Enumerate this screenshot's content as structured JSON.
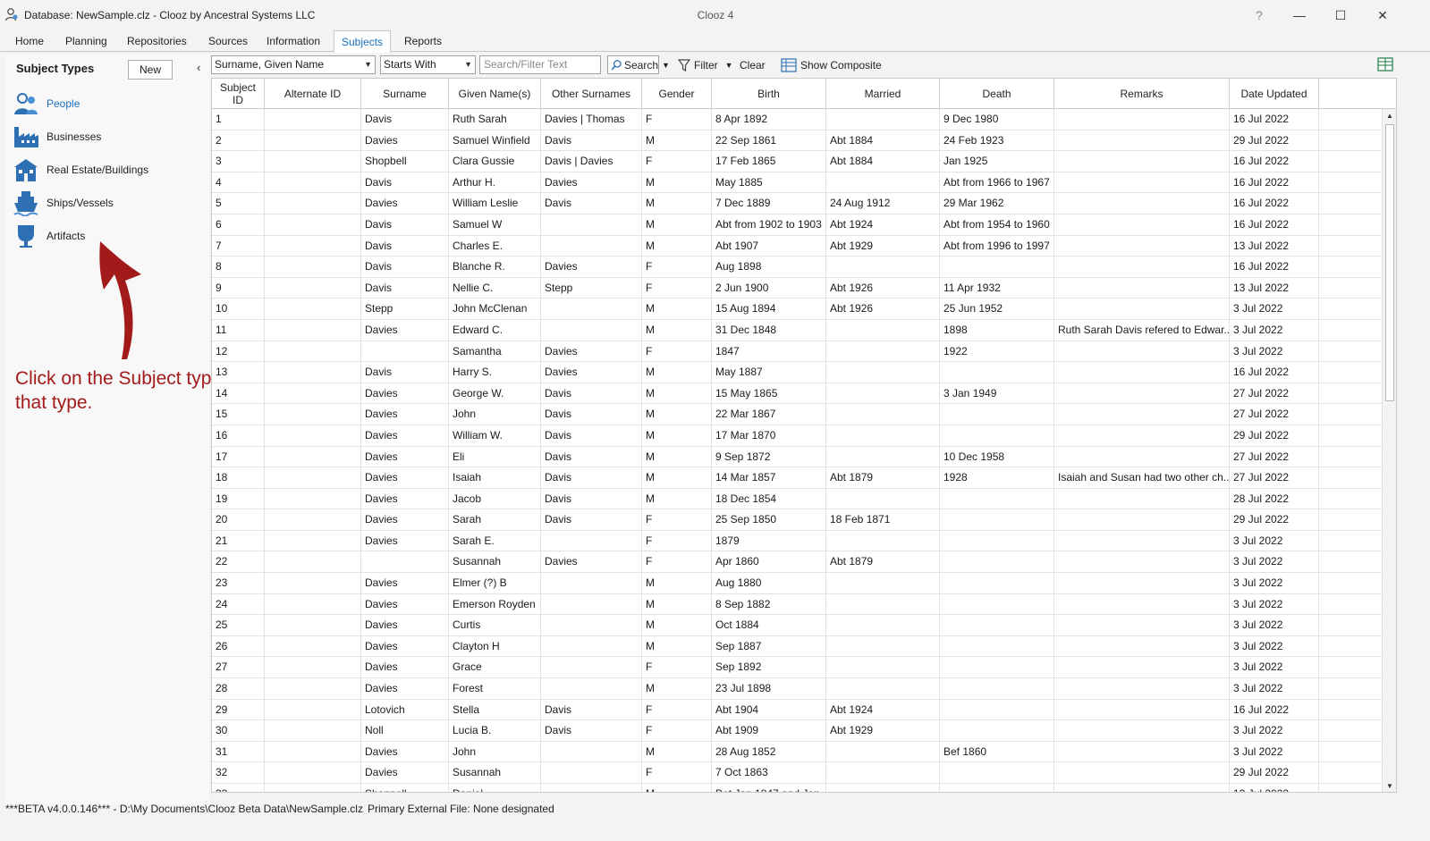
{
  "window": {
    "title": "Database: NewSample.clz - Clooz by Ancestral Systems LLC",
    "center_title": "Clooz 4",
    "help": "?",
    "minimize": "—",
    "maximize": "☐",
    "close": "✕"
  },
  "menu": {
    "tabs": [
      "Home",
      "Planning",
      "Repositories",
      "Sources",
      "Information",
      "Subjects",
      "Reports"
    ],
    "active": "Subjects"
  },
  "left_panel": {
    "header": "Subject Types",
    "new_label": "New",
    "collapse": "‹",
    "items": [
      {
        "label": "People",
        "icon": "people-icon",
        "active": true
      },
      {
        "label": "Businesses",
        "icon": "factory-icon",
        "active": false
      },
      {
        "label": "Real Estate/Buildings",
        "icon": "building-icon",
        "active": false
      },
      {
        "label": "Ships/Vessels",
        "icon": "ship-icon",
        "active": false
      },
      {
        "label": "Artifacts",
        "icon": "vase-icon",
        "active": false
      }
    ],
    "annotation_line1": "Click on the Subject type to list",
    "annotation_line2": "that type."
  },
  "toolbar": {
    "sort_select": "Surname, Given Name",
    "match_select": "Starts With",
    "search_placeholder": "Search/Filter Text",
    "search_label": "Search",
    "filter_label": "Filter",
    "clear_label": "Clear",
    "composite_label": "Show Composite"
  },
  "grid": {
    "columns": [
      "Subject ID",
      "Alternate ID",
      "Surname",
      "Given Name(s)",
      "Other Surnames",
      "Gender",
      "Birth",
      "Married",
      "Death",
      "Remarks",
      "Date Updated"
    ],
    "rows": [
      [
        "1",
        "",
        "Davis",
        "Ruth Sarah",
        "Davies | Thomas",
        "F",
        "8 Apr 1892",
        "",
        "9 Dec 1980",
        "",
        "16 Jul 2022"
      ],
      [
        "2",
        "",
        "Davies",
        "Samuel Winfield",
        "Davis",
        "M",
        "22 Sep 1861",
        "Abt 1884",
        "24 Feb 1923",
        "",
        "29 Jul 2022"
      ],
      [
        "3",
        "",
        "Shopbell",
        "Clara Gussie",
        "Davis | Davies",
        "F",
        "17 Feb 1865",
        "Abt 1884",
        "Jan 1925",
        "",
        "16 Jul 2022"
      ],
      [
        "4",
        "",
        "Davis",
        "Arthur H.",
        "Davies",
        "M",
        "May 1885",
        "",
        "Abt from 1966 to 1967",
        "",
        "16 Jul 2022"
      ],
      [
        "5",
        "",
        "Davies",
        "William Leslie",
        "Davis",
        "M",
        "7 Dec 1889",
        "24 Aug 1912",
        "29 Mar 1962",
        "",
        "16 Jul 2022"
      ],
      [
        "6",
        "",
        "Davis",
        "Samuel W",
        "",
        "M",
        "Abt from 1902 to 1903",
        "Abt 1924",
        "Abt from 1954 to 1960",
        "",
        "16 Jul 2022"
      ],
      [
        "7",
        "",
        "Davis",
        "Charles E.",
        "",
        "M",
        "Abt 1907",
        "Abt 1929",
        "Abt from 1996 to 1997",
        "",
        "13 Jul 2022"
      ],
      [
        "8",
        "",
        "Davis",
        "Blanche R.",
        "Davies",
        "F",
        "Aug 1898",
        "",
        "",
        "",
        "16 Jul 2022"
      ],
      [
        "9",
        "",
        "Davis",
        "Nellie C.",
        "Stepp",
        "F",
        "2 Jun 1900",
        "Abt 1926",
        "11 Apr 1932",
        "",
        "13 Jul 2022"
      ],
      [
        "10",
        "",
        "Stepp",
        "John McClenan",
        "",
        "M",
        "15 Aug 1894",
        "Abt 1926",
        "25 Jun 1952",
        "",
        "3 Jul 2022"
      ],
      [
        "11",
        "",
        "Davies",
        "Edward C.",
        "",
        "M",
        "31 Dec 1848",
        "",
        "1898",
        "Ruth Sarah Davis refered to Edwar...",
        "3 Jul 2022"
      ],
      [
        "12",
        "",
        "",
        "Samantha",
        "Davies",
        "F",
        "1847",
        "",
        "1922",
        "",
        "3 Jul 2022"
      ],
      [
        "13",
        "",
        "Davis",
        "Harry S.",
        "Davies",
        "M",
        "May 1887",
        "",
        "",
        "",
        "16 Jul 2022"
      ],
      [
        "14",
        "",
        "Davies",
        "George W.",
        "Davis",
        "M",
        "15 May 1865",
        "",
        "3 Jan 1949",
        "",
        "27 Jul 2022"
      ],
      [
        "15",
        "",
        "Davies",
        "John",
        "Davis",
        "M",
        "22 Mar 1867",
        "",
        "",
        "",
        "27 Jul 2022"
      ],
      [
        "16",
        "",
        "Davies",
        "William W.",
        "Davis",
        "M",
        "17 Mar 1870",
        "",
        "",
        "",
        "29 Jul 2022"
      ],
      [
        "17",
        "",
        "Davies",
        "Eli",
        "Davis",
        "M",
        "9 Sep 1872",
        "",
        "10 Dec 1958",
        "",
        "27 Jul 2022"
      ],
      [
        "18",
        "",
        "Davies",
        "Isaiah",
        "Davis",
        "M",
        "14 Mar 1857",
        "Abt 1879",
        "1928",
        "Isaiah and Susan had two other ch...",
        "27 Jul 2022"
      ],
      [
        "19",
        "",
        "Davies",
        "Jacob",
        "Davis",
        "M",
        "18 Dec 1854",
        "",
        "",
        "",
        "28 Jul 2022"
      ],
      [
        "20",
        "",
        "Davies",
        "Sarah",
        "Davis",
        "F",
        "25 Sep 1850",
        "18 Feb 1871",
        "",
        "",
        "29 Jul 2022"
      ],
      [
        "21",
        "",
        "Davies",
        "Sarah E.",
        "",
        "F",
        "1879",
        "",
        "",
        "",
        "3 Jul 2022"
      ],
      [
        "22",
        "",
        "",
        "Susannah",
        "Davies",
        "F",
        "Apr 1860",
        "Abt 1879",
        "",
        "",
        "3 Jul 2022"
      ],
      [
        "23",
        "",
        "Davies",
        "Elmer (?) B",
        "",
        "M",
        "Aug 1880",
        "",
        "",
        "",
        "3 Jul 2022"
      ],
      [
        "24",
        "",
        "Davies",
        "Emerson Royden",
        "",
        "M",
        "8 Sep 1882",
        "",
        "",
        "",
        "3 Jul 2022"
      ],
      [
        "25",
        "",
        "Davies",
        "Curtis",
        "",
        "M",
        "Oct 1884",
        "",
        "",
        "",
        "3 Jul 2022"
      ],
      [
        "26",
        "",
        "Davies",
        "Clayton H",
        "",
        "M",
        "Sep 1887",
        "",
        "",
        "",
        "3 Jul 2022"
      ],
      [
        "27",
        "",
        "Davies",
        "Grace",
        "",
        "F",
        "Sep 1892",
        "",
        "",
        "",
        "3 Jul 2022"
      ],
      [
        "28",
        "",
        "Davies",
        "Forest",
        "",
        "M",
        "23 Jul 1898",
        "",
        "",
        "",
        "3 Jul 2022"
      ],
      [
        "29",
        "",
        "Lotovich",
        "Stella",
        "Davis",
        "F",
        "Abt 1904",
        "Abt 1924",
        "",
        "",
        "16 Jul 2022"
      ],
      [
        "30",
        "",
        "Noll",
        "Lucia B.",
        "Davis",
        "F",
        "Abt 1909",
        "Abt 1929",
        "",
        "",
        "3 Jul 2022"
      ],
      [
        "31",
        "",
        "Davies",
        "John",
        "",
        "M",
        "28 Aug 1852",
        "",
        "Bef  1860",
        "",
        "3 Jul 2022"
      ],
      [
        "32",
        "",
        "Davies",
        "Susannah",
        "",
        "F",
        "7 Oct 1863",
        "",
        "",
        "",
        "29 Jul 2022"
      ],
      [
        "33",
        "",
        "Shoppell",
        "Daniel",
        "",
        "M",
        "Bet Jan 1847 and Jan",
        "",
        "",
        "",
        "13 Jul 2022"
      ]
    ]
  },
  "statusbar": {
    "version": "***BETA v4.0.0.146*** - D:\\My Documents\\Clooz Beta Data\\NewSample.clz",
    "external": "Primary External File: None designated"
  }
}
